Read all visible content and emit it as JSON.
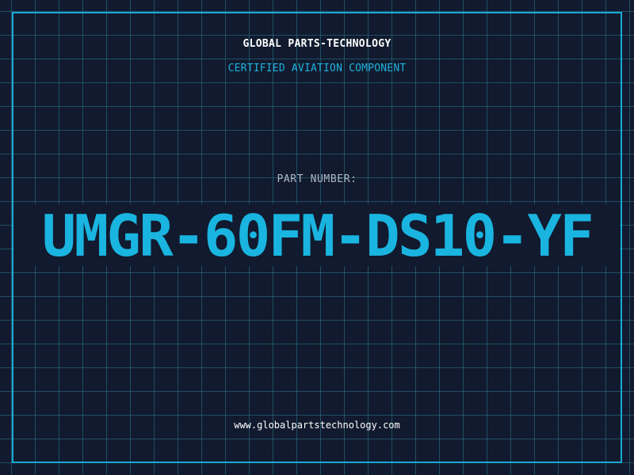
{
  "header": {
    "company_name": "GLOBAL PARTS-TECHNOLOGY",
    "tagline": "CERTIFIED AVIATION COMPONENT"
  },
  "part": {
    "label": "PART NUMBER:",
    "number": "UMGR-60FM-DS10-YF"
  },
  "footer": {
    "url": "www.globalpartstechnology.com"
  },
  "colors": {
    "background": "#111a2e",
    "grid": "#2c7a92",
    "accent": "#19a9d4",
    "label": "#aeb8c4",
    "text": "#ffffff"
  }
}
